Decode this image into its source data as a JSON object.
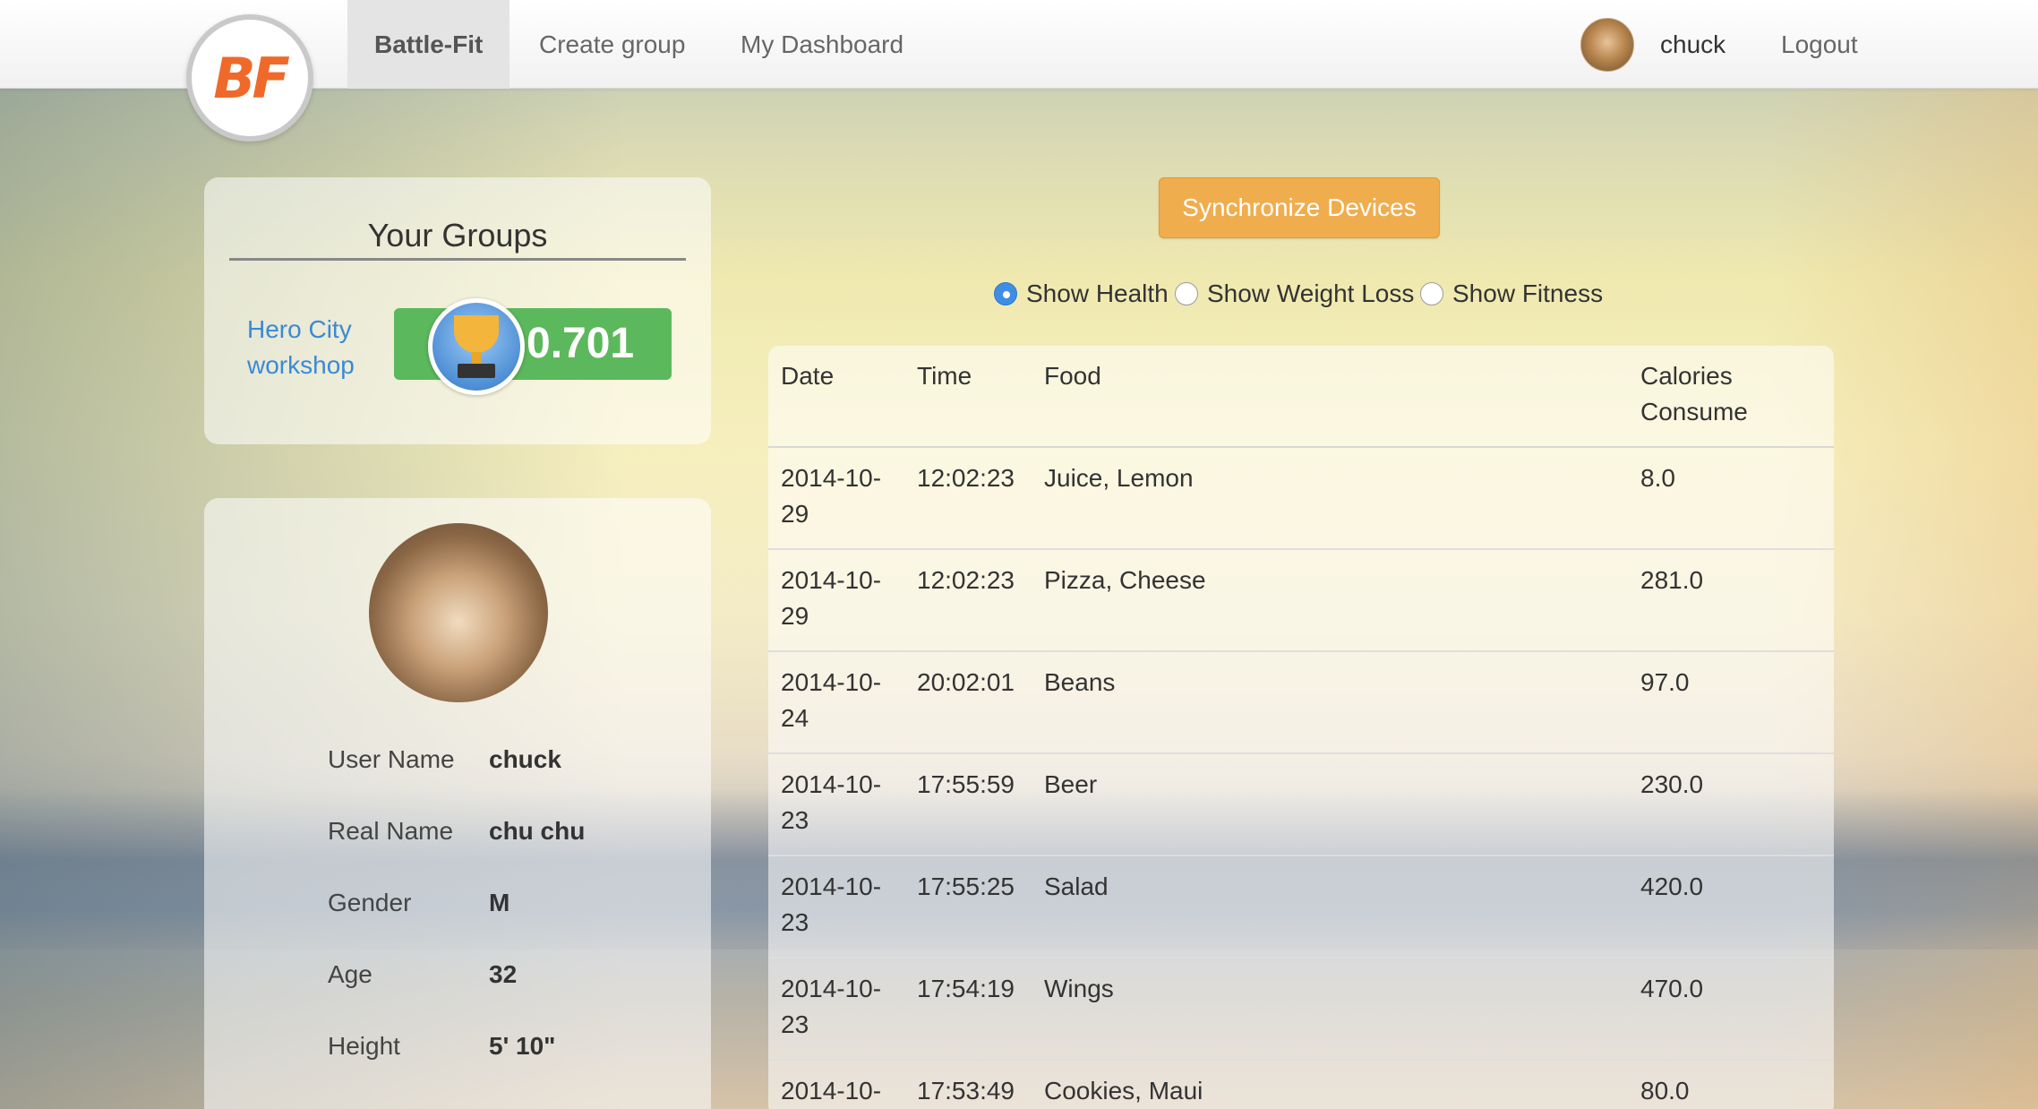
{
  "navbar": {
    "logo_text": "BF",
    "items": [
      {
        "label": "Battle-Fit",
        "active": true
      },
      {
        "label": "Create group",
        "active": false
      },
      {
        "label": "My Dashboard",
        "active": false
      }
    ],
    "username": "chuck",
    "logout_label": "Logout"
  },
  "groups": {
    "title": "Your Groups",
    "group_name": "Hero City workshop",
    "score": "0.701",
    "trophy_icon": "trophy-icon"
  },
  "profile": {
    "fields": [
      {
        "label": "User Name",
        "value": "chuck"
      },
      {
        "label": "Real Name",
        "value": "chu chu"
      },
      {
        "label": "Gender",
        "value": "M"
      },
      {
        "label": "Age",
        "value": "32"
      },
      {
        "label": "Height",
        "value": "5' 10\""
      }
    ]
  },
  "sync_button_label": "Synchronize Devices",
  "view_options": [
    {
      "label": "Show Health",
      "checked": true
    },
    {
      "label": "Show Weight Loss",
      "checked": false
    },
    {
      "label": "Show Fitness",
      "checked": false
    }
  ],
  "table": {
    "headers": [
      "Date",
      "Time",
      "Food",
      "Calories Consume"
    ],
    "rows": [
      {
        "date": "2014-10-29",
        "time": "12:02:23",
        "food": "Juice, Lemon",
        "calories": "8.0"
      },
      {
        "date": "2014-10-29",
        "time": "12:02:23",
        "food": "Pizza, Cheese",
        "calories": "281.0"
      },
      {
        "date": "2014-10-24",
        "time": "20:02:01",
        "food": "Beans",
        "calories": "97.0"
      },
      {
        "date": "2014-10-23",
        "time": "17:55:59",
        "food": "Beer",
        "calories": "230.0"
      },
      {
        "date": "2014-10-23",
        "time": "17:55:25",
        "food": "Salad",
        "calories": "420.0"
      },
      {
        "date": "2014-10-23",
        "time": "17:54:19",
        "food": "Wings",
        "calories": "470.0"
      },
      {
        "date": "2014-10-",
        "time": "17:53:49",
        "food": "Cookies, Maui",
        "calories": "80.0"
      }
    ]
  },
  "colors": {
    "brand_orange": "#ef6a2a",
    "sync_button": "#f0ad4e",
    "score_green": "#5cb85c",
    "link_blue": "#3a8ad4",
    "radio_checked": "#3e8ee6"
  }
}
